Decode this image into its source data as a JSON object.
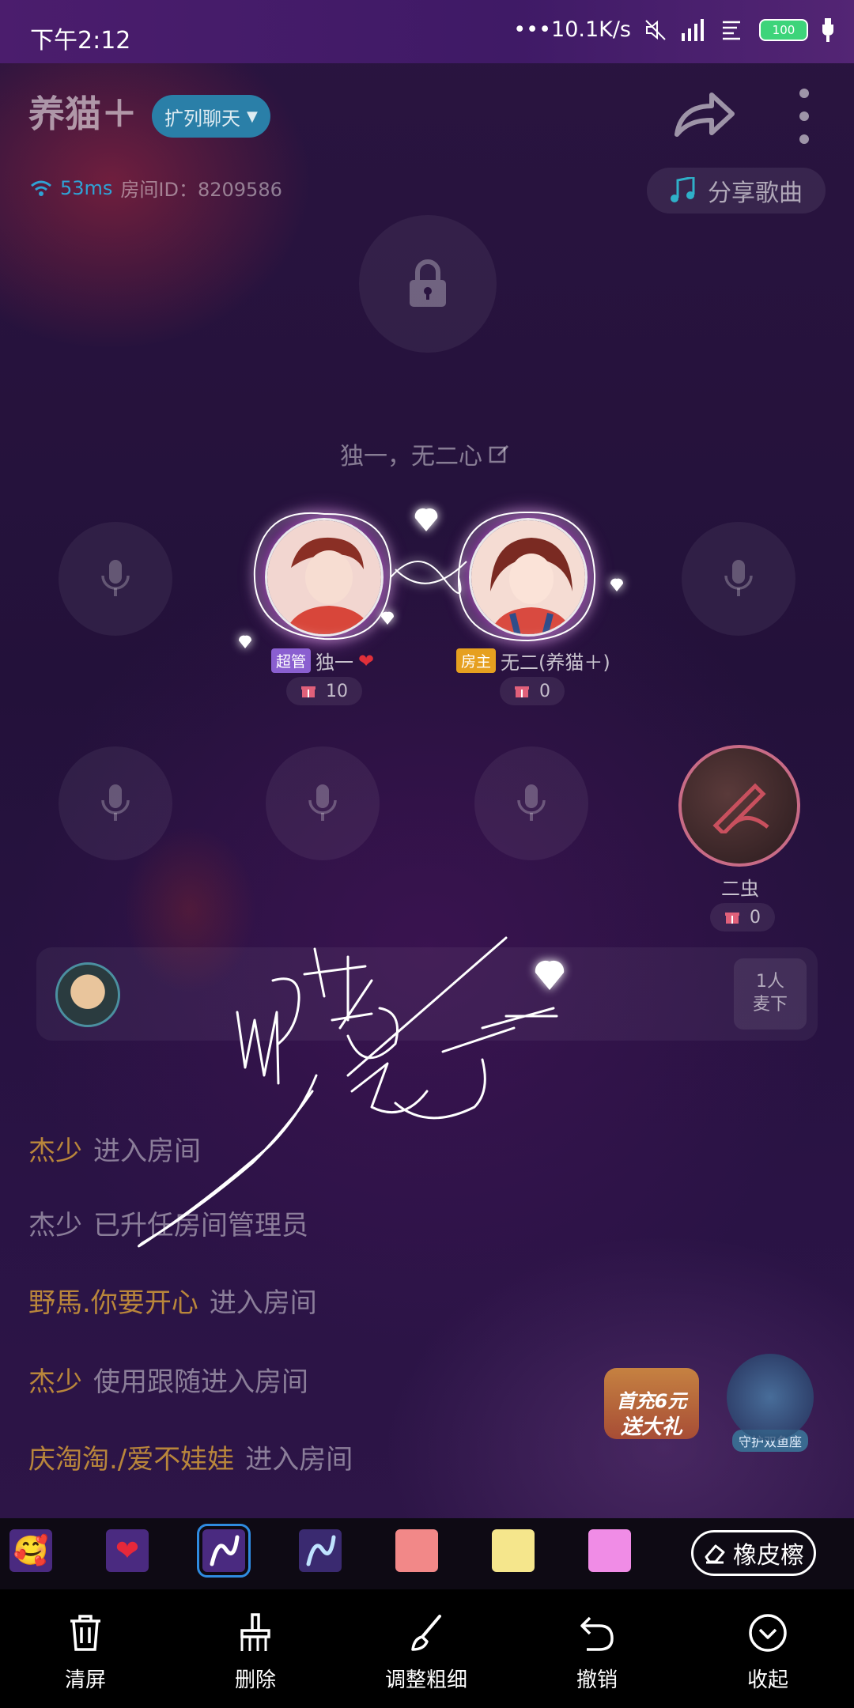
{
  "status": {
    "time": "下午2:12",
    "network_speed": "•••10.1K/s",
    "battery": "100"
  },
  "header": {
    "room_name": "养猫＋",
    "expand_chat_label": "扩列聊天",
    "ping": "53ms",
    "room_id": "房间ID：8209586",
    "share_song": "分享歌曲"
  },
  "room": {
    "motto": "独一，无二心"
  },
  "seats": {
    "seat1": {
      "tag": "超管",
      "name": "独一",
      "gifts": "10"
    },
    "seat2": {
      "tag": "房主",
      "name": "无二(养猫＋)",
      "gifts": "0"
    },
    "seat_chong": {
      "name": "二虫",
      "gifts": "0"
    }
  },
  "queue": {
    "button_line1": "1人",
    "button_line2": "麦下"
  },
  "messages": [
    {
      "nick": "杰少",
      "text": "进入房间"
    },
    {
      "nick": "杰少",
      "text": "已升任房间管理员"
    },
    {
      "nick": "野馬.你要开心",
      "text": "进入房间"
    },
    {
      "nick": "杰少",
      "text": "使用跟随进入房间"
    },
    {
      "nick": "庆淘淘./爱不娃娃",
      "text": "进入房间"
    }
  ],
  "promo": {
    "line1": "首充6元",
    "line2": "送大礼",
    "guard_label": "守护双鱼座"
  },
  "palette": {
    "colors": [
      "#f28888",
      "#f5e68c",
      "#f08ce6"
    ],
    "eraser_label": "橡皮檫"
  },
  "tools": {
    "clear": "清屏",
    "delete": "删除",
    "thickness": "调整粗细",
    "undo": "撤销",
    "collapse": "收起"
  },
  "icons": {
    "lock": "lock-icon",
    "mic": "microphone-icon",
    "share": "share-arrow-icon",
    "music": "music-note-icon",
    "wifi": "wifi-icon",
    "gift": "gift-icon",
    "edit": "edit-icon",
    "trash": "trash-icon",
    "brush": "brush-icon",
    "undo": "undo-icon",
    "collapse": "chevron-down-circle-icon"
  }
}
